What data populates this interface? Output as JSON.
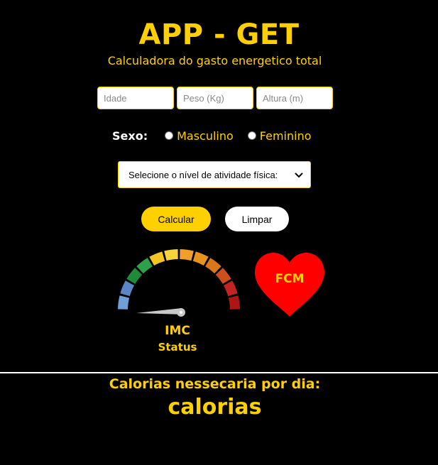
{
  "header": {
    "title": "APP - GET",
    "subtitle": "Calculadora do gasto energetico total"
  },
  "form": {
    "idade_placeholder": "Idade",
    "peso_placeholder": "Peso (Kg)",
    "altura_placeholder": "Altura (m)",
    "sexo_label": "Sexo:",
    "sexo_options": [
      "Masculino",
      "Feminino"
    ],
    "atividade_select": "Selecione o nível de atividade física:"
  },
  "buttons": {
    "calcular": "Calcular",
    "limpar": "Limpar"
  },
  "gauge": {
    "label": "IMC",
    "status": "Status",
    "segment_colors": [
      "#6f9fd8",
      "#5b86c5",
      "#1f8a3a",
      "#2fa04a",
      "#f3c623",
      "#f7d33c",
      "#f0a02a",
      "#e9921c",
      "#d9771a",
      "#cc4f1d",
      "#c22323",
      "#b01515"
    ]
  },
  "heart": {
    "label": "FCM",
    "color": "#ff0000"
  },
  "result": {
    "title": "Calorias nessecaria por dia:",
    "value": "calorias"
  },
  "colors": {
    "accent": "#FFD000",
    "background": "#000000"
  }
}
